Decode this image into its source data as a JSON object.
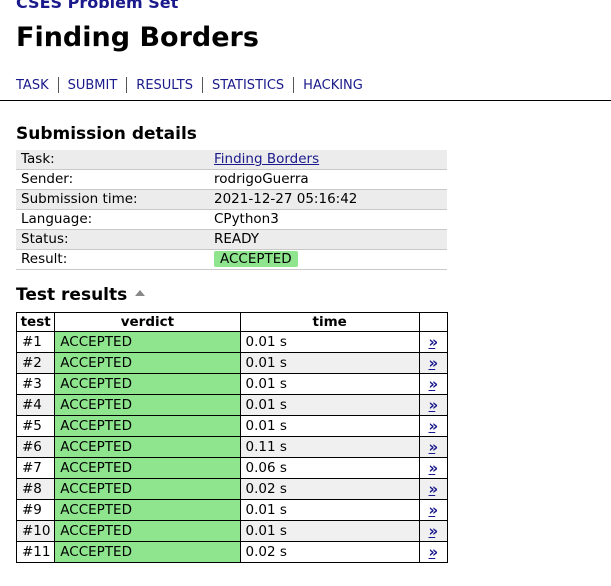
{
  "site_title": "CSES Problem Set",
  "page_title": "Finding Borders",
  "nav": [
    "TASK",
    "SUBMIT",
    "RESULTS",
    "STATISTICS",
    "HACKING"
  ],
  "details_heading": "Submission details",
  "details": {
    "task_label": "Task:",
    "task_value": "Finding Borders",
    "sender_label": "Sender:",
    "sender_value": "rodrigoGuerra",
    "time_label": "Submission time:",
    "time_value": "2021-12-27 05:16:42",
    "language_label": "Language:",
    "language_value": "CPython3",
    "status_label": "Status:",
    "status_value": "READY",
    "result_label": "Result:",
    "result_value": "ACCEPTED"
  },
  "results_heading": "Test results",
  "columns": [
    "test",
    "verdict",
    "time"
  ],
  "link_glyph": "»",
  "tests": [
    {
      "test": "#1",
      "verdict": "ACCEPTED",
      "time": "0.01 s"
    },
    {
      "test": "#2",
      "verdict": "ACCEPTED",
      "time": "0.01 s"
    },
    {
      "test": "#3",
      "verdict": "ACCEPTED",
      "time": "0.01 s"
    },
    {
      "test": "#4",
      "verdict": "ACCEPTED",
      "time": "0.01 s"
    },
    {
      "test": "#5",
      "verdict": "ACCEPTED",
      "time": "0.01 s"
    },
    {
      "test": "#6",
      "verdict": "ACCEPTED",
      "time": "0.11 s"
    },
    {
      "test": "#7",
      "verdict": "ACCEPTED",
      "time": "0.06 s"
    },
    {
      "test": "#8",
      "verdict": "ACCEPTED",
      "time": "0.02 s"
    },
    {
      "test": "#9",
      "verdict": "ACCEPTED",
      "time": "0.01 s"
    },
    {
      "test": "#10",
      "verdict": "ACCEPTED",
      "time": "0.01 s"
    },
    {
      "test": "#11",
      "verdict": "ACCEPTED",
      "time": "0.02 s"
    }
  ],
  "colors": {
    "link": "#1a1a8c",
    "accepted": "#8ee58e"
  },
  "icons": {
    "sort": "sort-up-icon",
    "details_link": "double-chevron-right-icon"
  }
}
